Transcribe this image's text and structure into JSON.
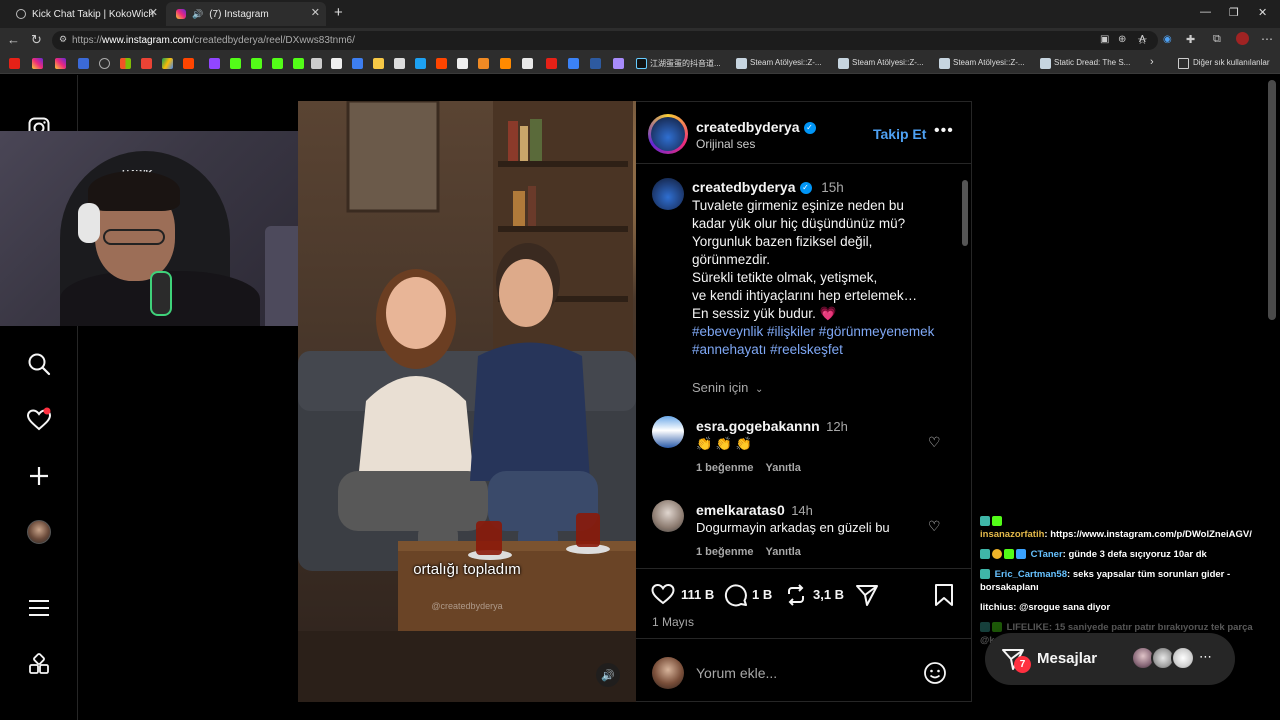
{
  "browser": {
    "tabs": [
      {
        "title": "Kick Chat Takip | KokoWich"
      },
      {
        "title": "(7) Instagram"
      }
    ],
    "url_prefix": "https://",
    "url_host": "www.instagram.com",
    "url_path": "/createdbyderya/reel/DXwws83tnm6/",
    "bookmarks": [
      "江湖蛋蛋的抖音道...",
      "Steam Atölyesi::Z-...",
      "Steam Atölyesi::Z-...",
      "Steam Atölyesi::Z-...",
      "Static Dread: The S..."
    ],
    "other_bookmarks": "Diğer sık kullanılanlar"
  },
  "post": {
    "username": "createdbyderya",
    "audio": "Orijinal ses",
    "follow": "Takip Et",
    "caption_time": "15h",
    "caption_lines": [
      "Tuvalete girmeniz eşinize neden bu",
      "kadar yük olur hiç düşündünüz mü?",
      "Yorgunluk bazen fiziksel değil,",
      "görünmezdir.",
      "Sürekli tetikte olmak, yetişmek,",
      "ve kendi ihtiyaçlarını hep ertelemek…",
      "En sessiz yük budur. 💗"
    ],
    "hashtags_1": "#ebeveynlik #ilişkiler #görünmeyenemek",
    "hashtags_2": "#annehayatı #reelskeşfet",
    "for_you": "Senin için",
    "comments": [
      {
        "user": "esra.gogebakannn",
        "time": "12h",
        "text": "👏 👏 👏",
        "likes": "1 beğenme",
        "reply": "Yanıtla"
      },
      {
        "user": "emelkaratas0",
        "time": "14h",
        "text": "Dogurmayin arkadaş en güzeli bu",
        "likes": "1 beğenme",
        "reply": "Yanıtla"
      }
    ],
    "likes": "111 B",
    "comments_count": "1 B",
    "reposts": "3,1 B",
    "date": "1 Mayıs",
    "add_comment_placeholder": "Yorum ekle..."
  },
  "reel": {
    "subtitle": "ortalığı topladım",
    "watermark": "@createdbyderya"
  },
  "webcam": {
    "headset_brand": "HAWK"
  },
  "chat": [
    {
      "user": "insanazorfatih",
      "text": "https://www.instagram.com/p/DWolZneiAGV/"
    },
    {
      "user": "CTaner",
      "text": "günde 3 defa sıçıyoruz 10ar dk"
    },
    {
      "user": "Eric_Cartman58",
      "text": "seks yapsalar tüm sorunları gider - borsakaplanı"
    },
    {
      "user": "litchius",
      "text": "@srogue sana diyor"
    },
    {
      "user": "LIFELIKE",
      "text": "15 saniyede patır patır bırakıyoruz tek parça"
    },
    {
      "user": "",
      "text": "@kajiiri"
    }
  ],
  "messages": {
    "label": "Mesajlar",
    "count": "7"
  },
  "colors": {
    "accent_blue": "#0095f6",
    "follow_blue": "#4ea1f3",
    "hashtag": "#7fa8f5",
    "notif_red": "#ff3040"
  }
}
